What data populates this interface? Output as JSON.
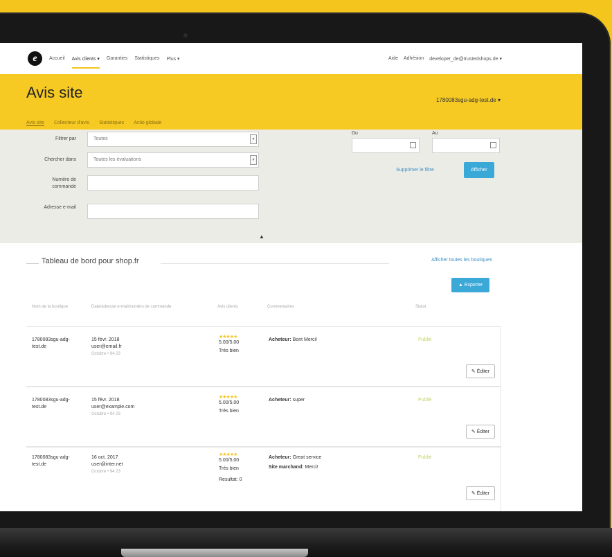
{
  "nav": {
    "logo": "e",
    "items": [
      "Accueil",
      "Avis clients ▾",
      "Garanties",
      "Statistiques",
      "Plus ▾"
    ],
    "right": [
      "Aide",
      "Adhésion",
      "developer_de@trustedshops.de ▾"
    ]
  },
  "header": {
    "title": "Avis site",
    "shop": "1780083sgu-adg-test.de ▾",
    "tabs": [
      "Avis site",
      "Collecteur d'avis",
      "Statistiques",
      "Actio globale"
    ]
  },
  "filters": {
    "filter_by_label": "Filtrer par",
    "filter_by_value": "Toutes",
    "search_in_label": "Chercher dans",
    "search_in_value": "Toutes les évaluations",
    "order_label": "Numéro de commande",
    "email_label": "Adresse e-mail",
    "from_label": "Du",
    "to_label": "Au",
    "clear_label": "Supprimer le filtre",
    "show_label": "Afficher"
  },
  "dashboard": {
    "title": "Tableau de bord pour shop.fr",
    "all_shops_label": "Afficher toutes les boutiques",
    "export_label": "▲ Exporter",
    "columns": [
      "Nom de la boutique",
      "Date/adresse e-mail/numéro de commande",
      "Avis clients",
      "Commentaires",
      "Statut"
    ],
    "rows": [
      {
        "shop": "1780083sgu-adg-test.de",
        "date": "15 févr. 2018",
        "email": "user@email.fr",
        "order": "Octobre • 94 23",
        "stars": "★★★★★",
        "score": "5.00/5.00",
        "rating_text": "Très bien",
        "comment_label": "Acheteur:",
        "comment": "Bont Merci!",
        "shop_comment_label": "",
        "shop_comment": "",
        "extra": "",
        "status": "Publié",
        "edit_label": "✎ Éditer"
      },
      {
        "shop": "1780083sgu-adg-test.de",
        "date": "15 févr. 2018",
        "email": "user@example.com",
        "order": "Octobre • 94 23",
        "stars": "★★★★★",
        "score": "5.00/5.00",
        "rating_text": "Très bien",
        "comment_label": "Acheteur:",
        "comment": "super",
        "shop_comment_label": "",
        "shop_comment": "",
        "extra": "",
        "status": "Publié",
        "edit_label": "✎ Éditer"
      },
      {
        "shop": "1780083sgu-adg-test.de",
        "date": "16 oct. 2017",
        "email": "user@inter.net",
        "order": "Octobre • 94 23",
        "stars": "★★★★★",
        "score": "5.00/5.00",
        "rating_text": "Très bien",
        "comment_label": "Acheteur:",
        "comment": "Great service",
        "shop_comment_label": "Site marchand:",
        "shop_comment": "Merci!",
        "extra": "Resultat: 0",
        "status": "Publié",
        "edit_label": "✎ Éditer"
      }
    ]
  }
}
